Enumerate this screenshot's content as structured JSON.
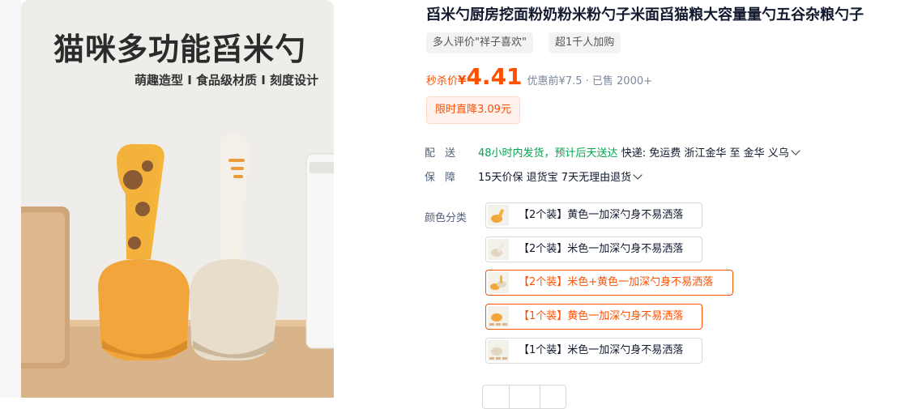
{
  "hero": {
    "title": "猫咪多功能舀米勺",
    "subtitle": "萌趣造型 I 食品级材质 I 刻度设计"
  },
  "product": {
    "title": "舀米勺厨房挖面粉奶粉米粉勺子米面舀猫粮大容量量勺五谷杂粮勺子",
    "tags": [
      "多人评价\"祥子喜欢\"",
      "超1千人加购"
    ]
  },
  "price": {
    "label": "秒杀价",
    "currency": "¥",
    "value": "4.41",
    "extra": "优惠前¥7.5 · 已售 2000+",
    "promo": "限时直降3.09元",
    "accent_color": "#ff5000"
  },
  "shipping": {
    "label": "配送",
    "highlight": "48小时内发货，预计后天送达",
    "detail": "快递: 免运费  浙江金华  至  金华 义乌"
  },
  "guarantee": {
    "label": "保障",
    "detail": "15天价保 退货宝 7天无理由退货"
  },
  "color": {
    "label": "颜色分类",
    "options": [
      {
        "label": "【2个装】黄色一加深勺身不易洒落",
        "selected": false,
        "thumb": "yellow-scoop"
      },
      {
        "label": "【2个装】米色一加深勺身不易洒落",
        "selected": false,
        "thumb": "beige-scoop"
      },
      {
        "label": "【2个装】米色+黄色一加深勺身不易洒落",
        "selected": true,
        "thumb": "mixed-scoop"
      },
      {
        "label": "【1个装】黄色一加深勺身不易洒落",
        "selected": true,
        "thumb": "yellow-scoop"
      },
      {
        "label": "【1个装】米色一加深勺身不易洒落",
        "selected": false,
        "thumb": "beige-scoop"
      }
    ]
  }
}
